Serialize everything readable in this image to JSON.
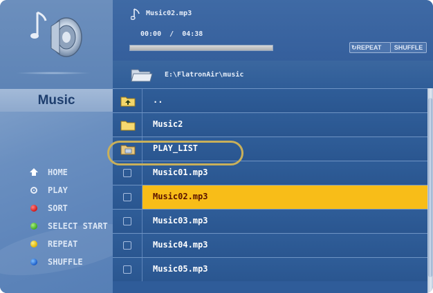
{
  "player": {
    "track": "Music02.mp3",
    "time_current": "00:00",
    "time_total": "04:38",
    "progress": 0.0,
    "repeat_label": "↻REPEAT",
    "shuffle_label": "SHUFFLE"
  },
  "path": "E:\\FlatronAir\\music",
  "category": "Music",
  "menu": [
    {
      "label": "HOME",
      "icon": "home-icon"
    },
    {
      "label": "PLAY",
      "icon": "play-icon"
    },
    {
      "label": "SORT",
      "icon": "red-button-icon"
    },
    {
      "label": "SELECT START",
      "icon": "green-button-icon"
    },
    {
      "label": "REPEAT",
      "icon": "yellow-button-icon"
    },
    {
      "label": "SHUFFLE",
      "icon": "blue-button-icon"
    }
  ],
  "files": [
    {
      "name": "..",
      "type": "parent-folder"
    },
    {
      "name": "Music2",
      "type": "folder"
    },
    {
      "name": "PLAY_LIST",
      "type": "playlist"
    },
    {
      "name": "Music01.mp3",
      "type": "file"
    },
    {
      "name": "Music02.mp3",
      "type": "file",
      "selected": true
    },
    {
      "name": "Music03.mp3",
      "type": "file"
    },
    {
      "name": "Music04.mp3",
      "type": "file"
    },
    {
      "name": "Music05.mp3",
      "type": "file"
    }
  ],
  "colors": {
    "highlight": "#f8bd18",
    "panel": "#2f5d98",
    "ring": "#c9b05a"
  }
}
